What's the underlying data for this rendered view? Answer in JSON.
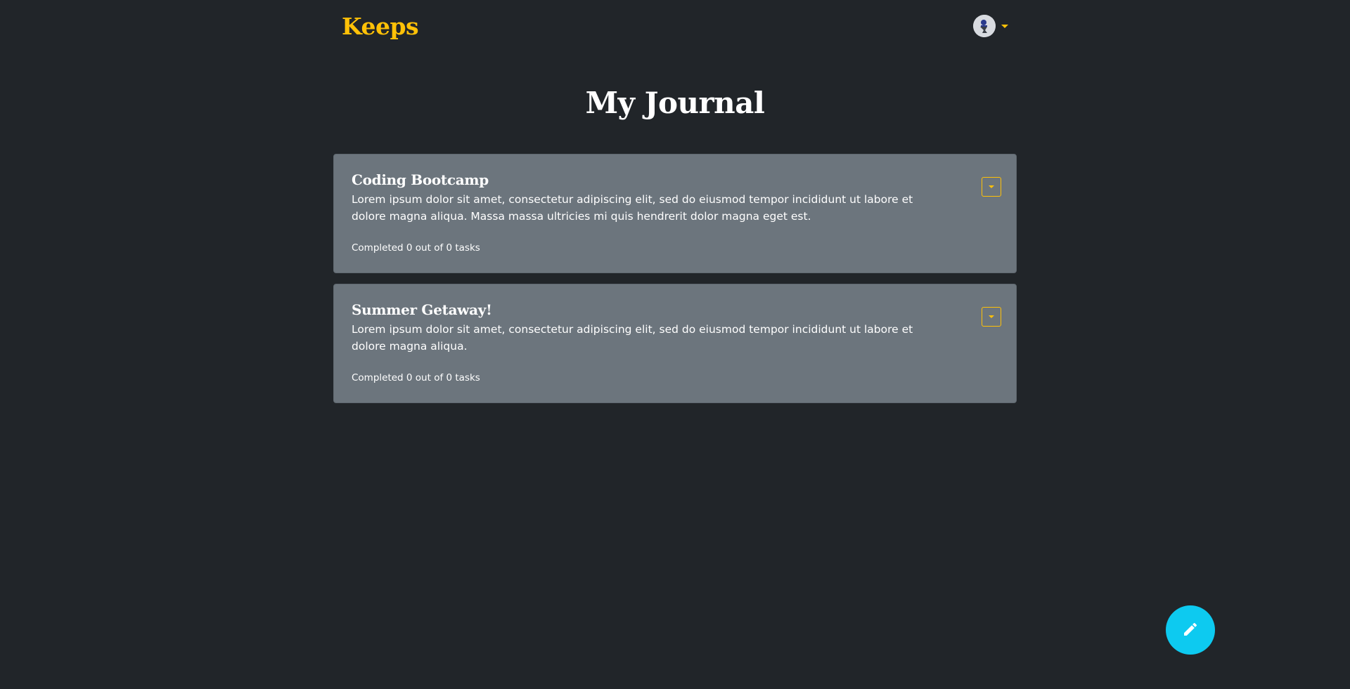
{
  "navbar": {
    "brand": "Keeps",
    "user_avatar_icon": "user-avatar-icon",
    "dropdown_icon": "caret-down-icon"
  },
  "page": {
    "title": "My Journal"
  },
  "entries": [
    {
      "title": "Coding Bootcamp",
      "body": "Lorem ipsum dolor sit amet, consectetur adipiscing elit, sed do eiusmod tempor incididunt ut labore et dolore magna aliqua. Massa massa ultricies mi quis hendrerit dolor magna eget est.",
      "status": "Completed 0 out of 0 tasks"
    },
    {
      "title": "Summer Getaway!",
      "body": "Lorem ipsum dolor sit amet, consectetur adipiscing elit, sed do eiusmod tempor incididunt ut labore et dolore magna aliqua.",
      "status": "Completed 0 out of 0 tasks"
    }
  ],
  "fab": {
    "icon": "pencil-icon"
  },
  "colors": {
    "background": "#212529",
    "accent": "#ffc107",
    "card": "#6c757d",
    "fab": "#0dcaf0"
  }
}
